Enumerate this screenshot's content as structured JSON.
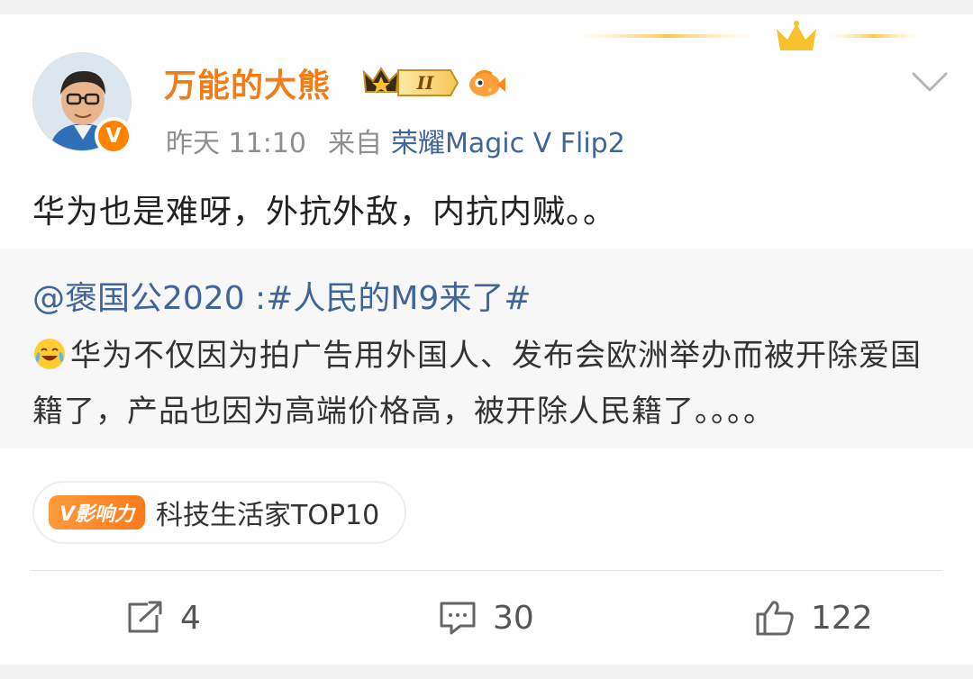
{
  "post": {
    "username": "万能的大熊",
    "vip_level": "II",
    "avatar_badge": "V",
    "time": "昨天 11:10",
    "source_label": "来自",
    "device": "荣耀Magic V Flip2",
    "text": "华为也是难呀，外抗外敌，内抗内贼。。"
  },
  "repost": {
    "author_and_topic": "@褒国公2020 :#人民的M9来了#",
    "body": "华为不仅因为拍广告用外国人、发布会欧洲举办而被开除爱国籍了，产品也因为高端价格高，被开除人民籍了。。。。"
  },
  "influence": {
    "badge_label": "V影响力",
    "title": "科技生活家TOP10"
  },
  "actions": {
    "share_count": "4",
    "comment_count": "30",
    "like_count": "122"
  },
  "colors": {
    "username": "#f07d18",
    "link": "#406599",
    "meta": "#8f8f8f",
    "repost_bg": "#f7f7f7"
  },
  "icons": {
    "share": "share-icon",
    "comment": "comment-icon",
    "like": "thumbs-up-icon",
    "more": "chevron-down-icon"
  }
}
